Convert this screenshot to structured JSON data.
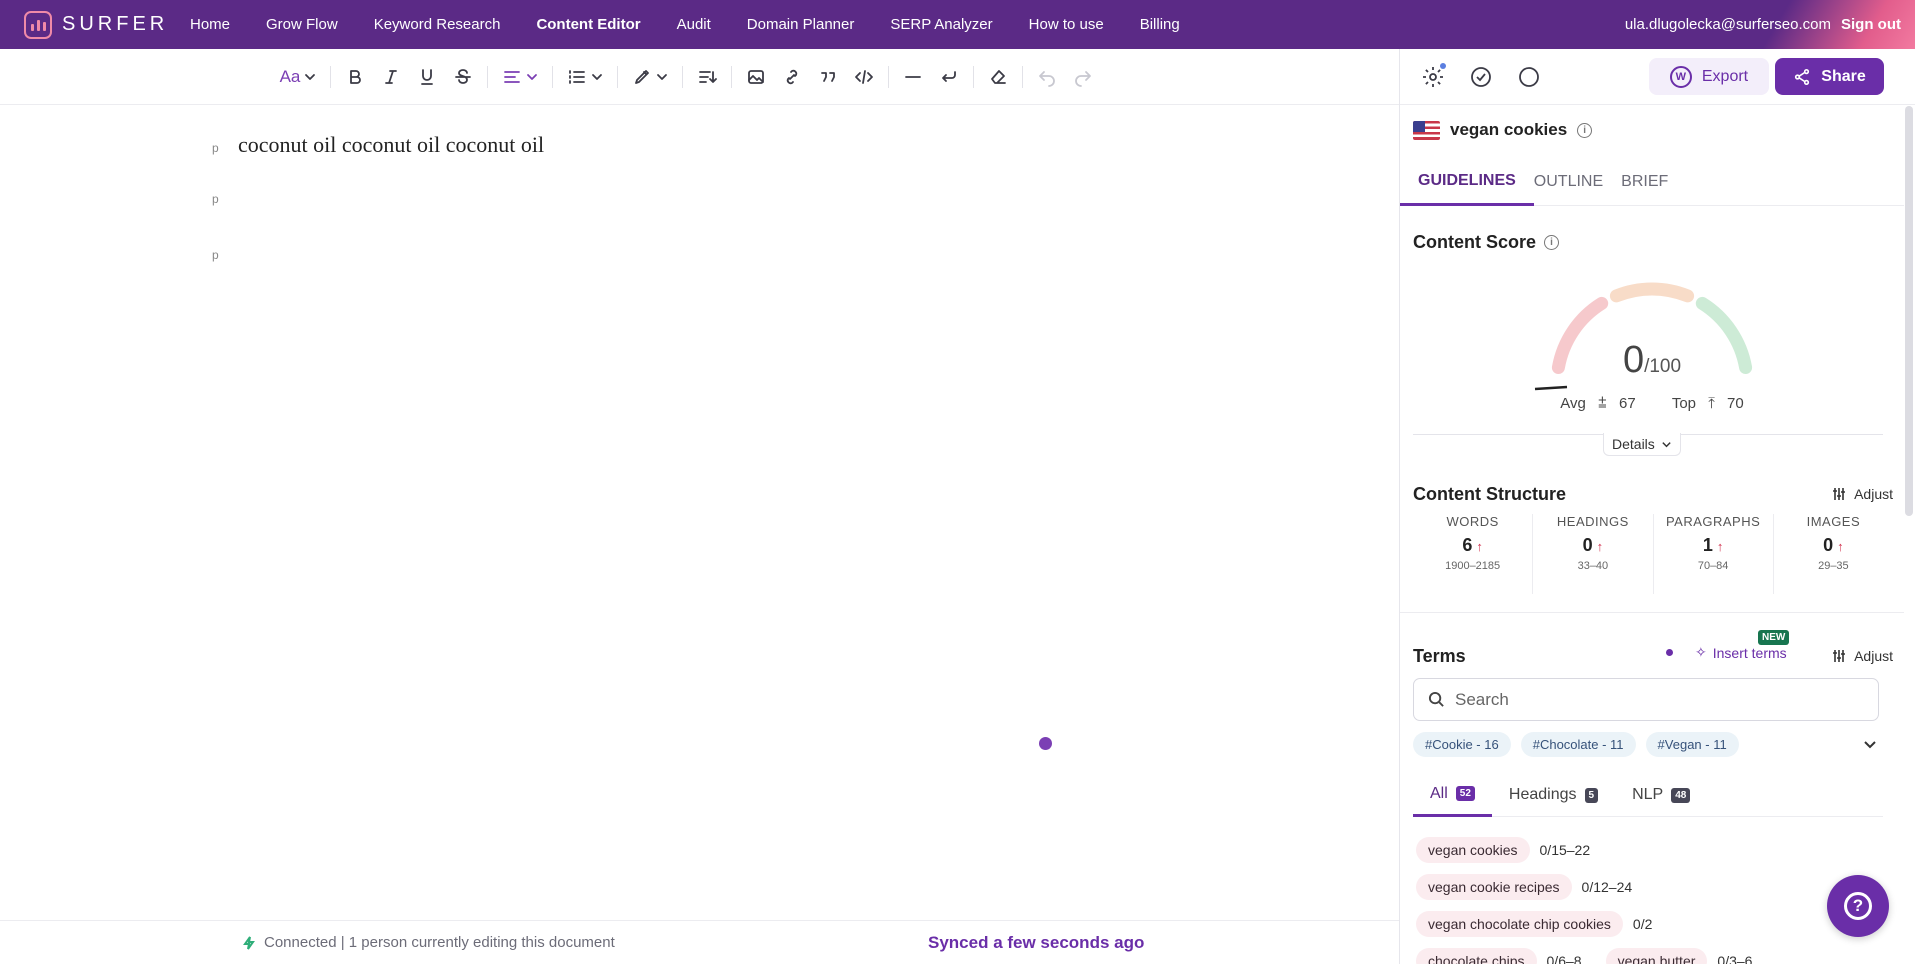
{
  "app": {
    "logo": "SURFER",
    "nav": [
      "Home",
      "Grow Flow",
      "Keyword Research",
      "Content Editor",
      "Audit",
      "Domain Planner",
      "SERP Analyzer",
      "How to use",
      "Billing"
    ],
    "active_nav": "Content Editor",
    "user_email": "ula.dlugolecka@surferseo.com",
    "sign_out": "Sign out"
  },
  "toolbar": {
    "font_label": "Aa",
    "icons": [
      "font-size-icon",
      "bold-icon",
      "italic-icon",
      "underline-icon",
      "strikethrough-icon",
      "align-icon",
      "list-icon",
      "highlight-icon",
      "line-height-icon",
      "image-icon",
      "link-icon",
      "quote-icon",
      "code-icon",
      "horizontal-rule-icon",
      "hard-break-icon",
      "clear-format-icon",
      "undo-icon",
      "redo-icon"
    ]
  },
  "editor": {
    "paragraphs": [
      {
        "tag": "p",
        "text": "coconut oil coconut oil coconut oil"
      },
      {
        "tag": "p",
        "text": ""
      },
      {
        "tag": "p",
        "text": ""
      }
    ]
  },
  "status": {
    "connection": "Connected | 1 person currently editing this document",
    "sync": "Synced a few seconds ago"
  },
  "panel": {
    "export_label": "Export",
    "share_label": "Share",
    "keyword": "vegan cookies",
    "tabs": [
      "GUIDELINES",
      "OUTLINE",
      "BRIEF"
    ],
    "active_tab": "GUIDELINES",
    "content_score": {
      "title": "Content Score",
      "score": "0",
      "max": "/100",
      "avg_label": "Avg",
      "avg": "67",
      "top_label": "Top",
      "top": "70",
      "details_label": "Details",
      "colors": {
        "low": "#f6c9cc",
        "mid": "#f8dcc8",
        "high": "#cdebd6"
      }
    },
    "structure": {
      "title": "Content Structure",
      "adjust_label": "Adjust",
      "columns": [
        {
          "label": "WORDS",
          "value": "6",
          "range": "1900–2185"
        },
        {
          "label": "HEADINGS",
          "value": "0",
          "range": "33–40"
        },
        {
          "label": "PARAGRAPHS",
          "value": "1",
          "range": "70–84"
        },
        {
          "label": "IMAGES",
          "value": "0",
          "range": "29–35"
        }
      ]
    },
    "terms": {
      "title": "Terms",
      "insert_label": "Insert terms",
      "new_badge": "NEW",
      "adjust_label": "Adjust",
      "search_placeholder": "Search",
      "chips": [
        "#Cookie - 16",
        "#Chocolate - 11",
        "#Vegan - 11"
      ],
      "tabs": [
        {
          "label": "All",
          "count": "52"
        },
        {
          "label": "Headings",
          "count": "5"
        },
        {
          "label": "NLP",
          "count": "48"
        }
      ],
      "list": [
        [
          {
            "term": "vegan cookies",
            "count": "0/15–22"
          }
        ],
        [
          {
            "term": "vegan cookie recipes",
            "count": "0/12–24"
          }
        ],
        [
          {
            "term": "vegan chocolate chip cookies",
            "count": "0/2"
          }
        ],
        [
          {
            "term": "chocolate chips",
            "count": "0/6–8"
          },
          {
            "term": "vegan butter",
            "count": "0/3–6"
          }
        ]
      ]
    }
  }
}
